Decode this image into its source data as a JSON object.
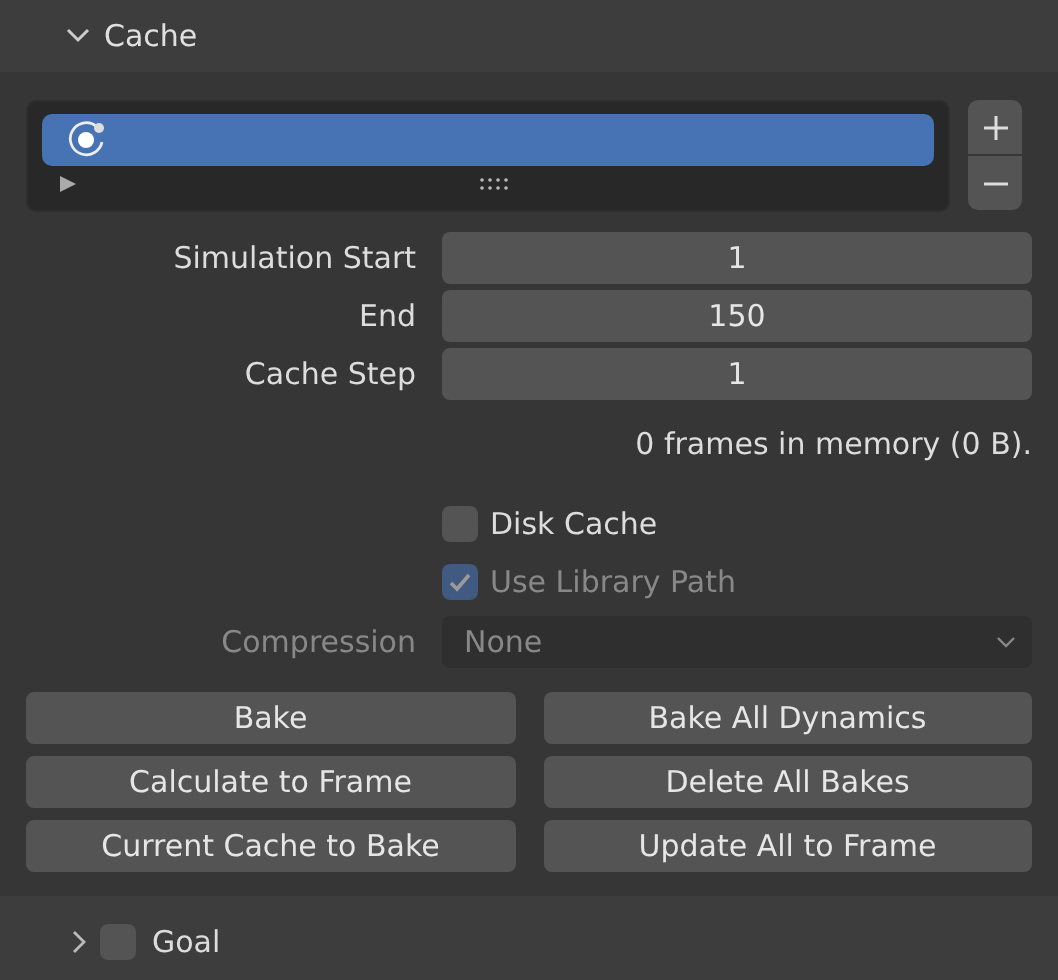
{
  "panel": {
    "title": "Cache",
    "expanded": true
  },
  "cache_list": {
    "items": [
      {
        "selected": true
      }
    ]
  },
  "fields": [
    {
      "label": "Simulation Start",
      "value": "1"
    },
    {
      "label": "End",
      "value": "150"
    },
    {
      "label": "Cache Step",
      "value": "1"
    }
  ],
  "memory_info": "0 frames in memory (0 B).",
  "options": [
    {
      "label": "Disk Cache",
      "checked": false,
      "disabled": false
    },
    {
      "label": "Use Library Path",
      "checked": true,
      "disabled": true
    }
  ],
  "compression": {
    "label": "Compression",
    "value": "None",
    "disabled": true
  },
  "buttons": [
    "Bake",
    "Bake All Dynamics",
    "Calculate to Frame",
    "Delete All Bakes",
    "Current Cache to Bake",
    "Update All to Frame"
  ],
  "goal": {
    "title": "Goal",
    "expanded": false,
    "checked": false
  }
}
